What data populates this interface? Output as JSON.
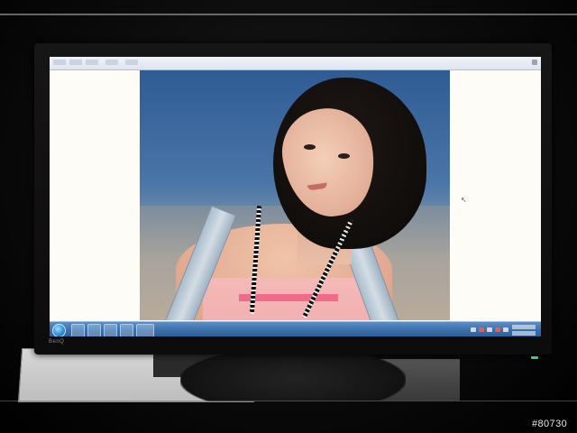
{
  "scene": {
    "description_colors": {
      "bezel": "#111111",
      "taskbar": "#3a6ea9",
      "page_background": "#fdfcf6",
      "sky": "#2f5c94",
      "tank_top": "#f4b9b6"
    }
  },
  "monitor": {
    "brand_logo": "BenQ"
  },
  "watermark": {
    "text": "#80730"
  },
  "icons": [
    "start-orb-icon",
    "taskbar-app-icon",
    "system-tray-icon",
    "mouse-cursor-icon"
  ]
}
